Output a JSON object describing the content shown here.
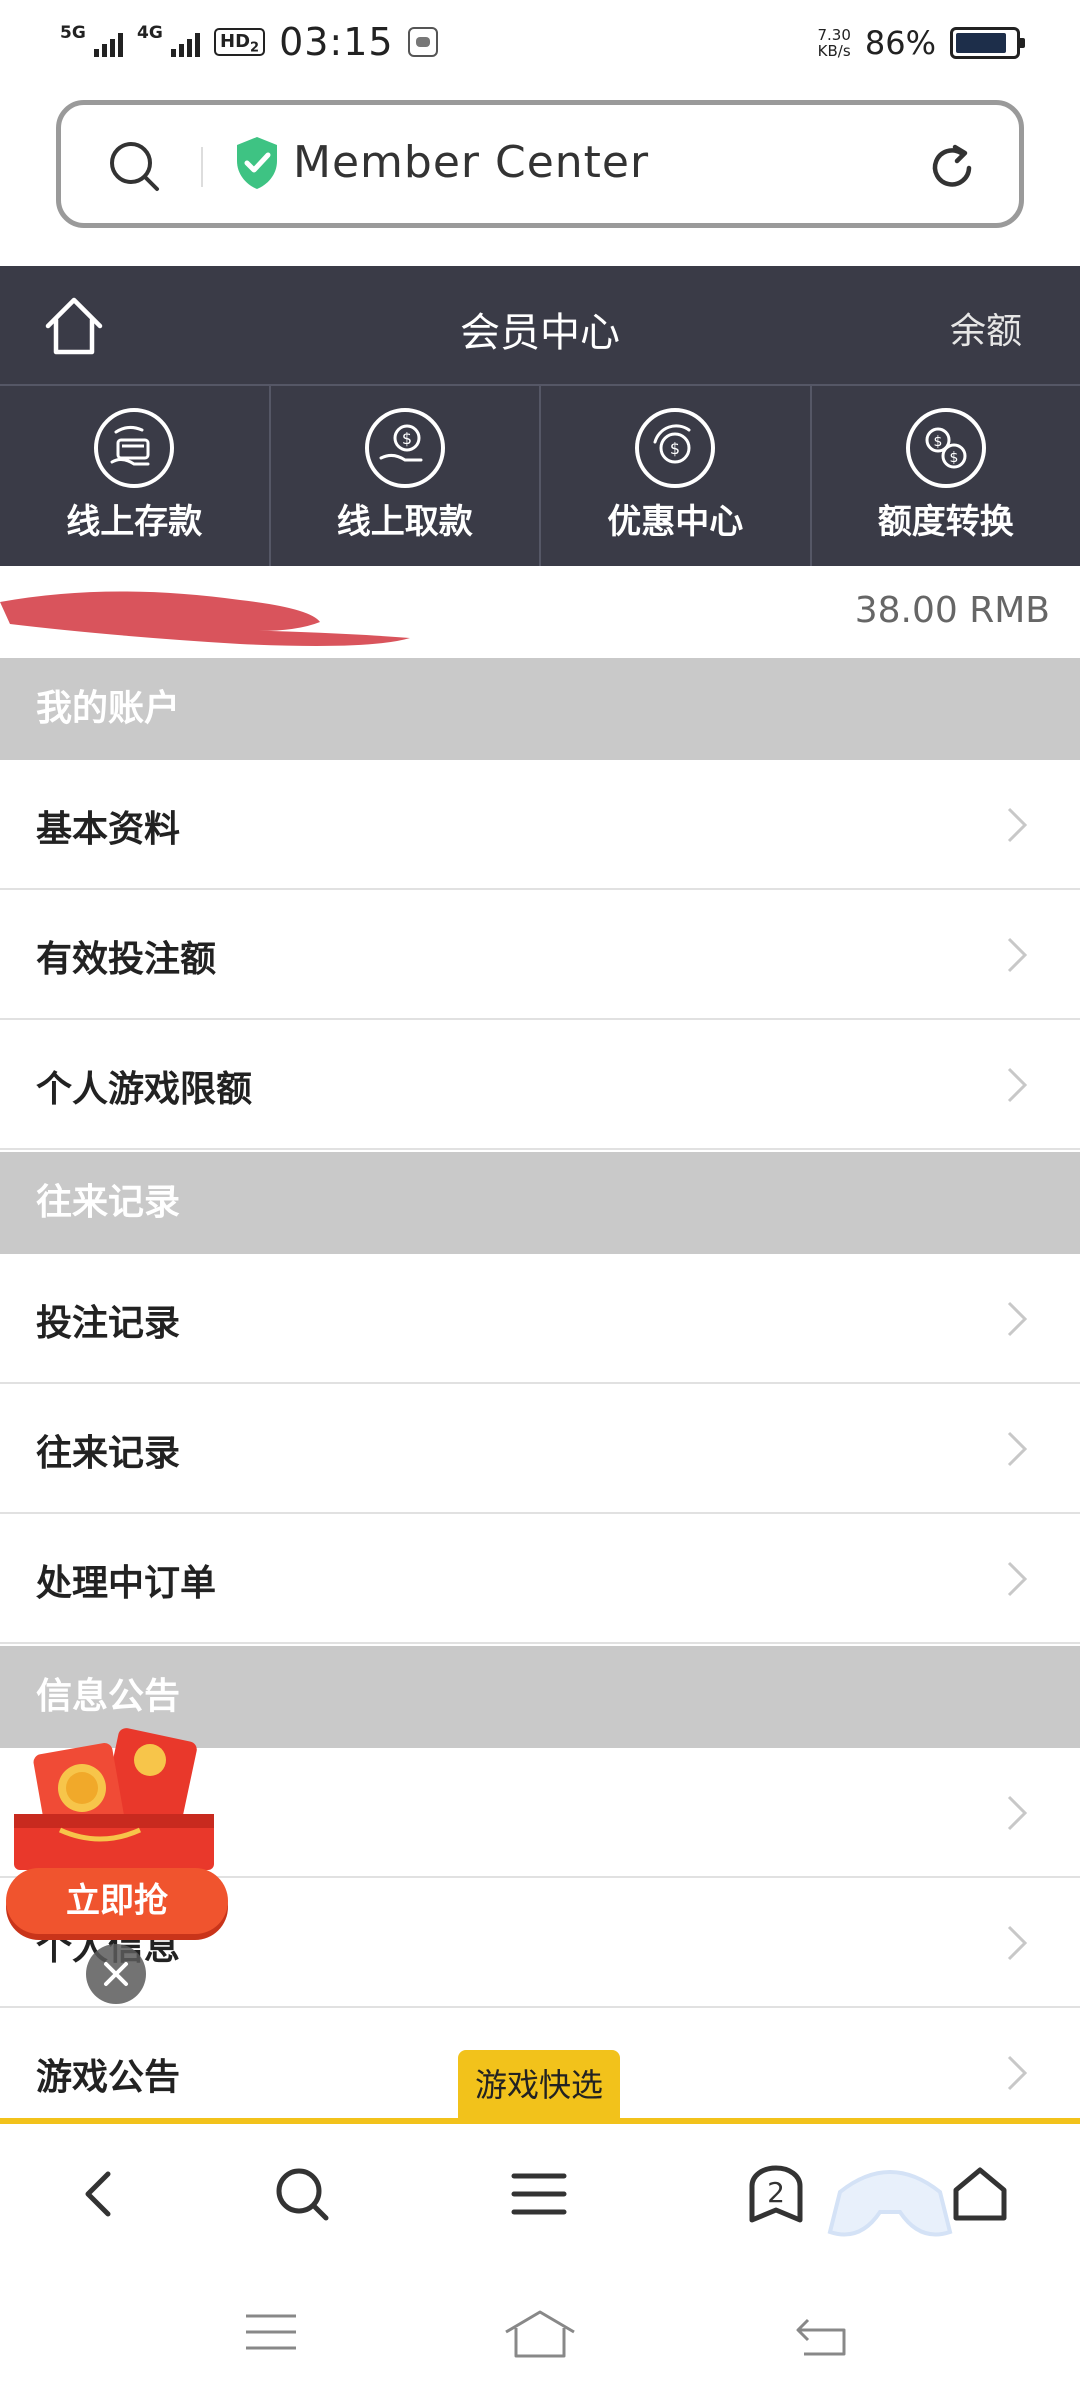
{
  "status_bar": {
    "sim1": "5G",
    "sim2": "4G",
    "hd": "HD",
    "hd_sub": "2",
    "time": "03:15",
    "speed_value": "7.30",
    "speed_unit": "KB/s",
    "battery": "86%",
    "battery_level": 0.86
  },
  "url_bar": {
    "text": "Member  Center",
    "shield_color": "#3ec383"
  },
  "header": {
    "title": "会员中心",
    "balance_link": "余额",
    "bg_color": "#3a3b47"
  },
  "quick_actions": [
    {
      "label": "线上存款",
      "icon": "card-hand-icon"
    },
    {
      "label": "线上取款",
      "icon": "coin-hand-icon"
    },
    {
      "label": "优惠中心",
      "icon": "coin-refresh-icon"
    },
    {
      "label": "额度转换",
      "icon": "coins-exchange-icon"
    }
  ],
  "balance": {
    "amount": "38.00 RMB"
  },
  "sections": {
    "account": {
      "title": "我的账户",
      "items": [
        "基本资料",
        "有效投注额",
        "个人游戏限额"
      ]
    },
    "records": {
      "title": "往来记录",
      "items": [
        "投注记录",
        "往来记录",
        "处理中订单"
      ]
    },
    "info": {
      "title": "信息公告",
      "items": [
        "",
        "个人信息",
        "游戏公告"
      ]
    }
  },
  "promo": {
    "button_label": "立即抢"
  },
  "game_tab": {
    "label": "游戏快选"
  },
  "browser_bar": {
    "tab_count": "2"
  }
}
